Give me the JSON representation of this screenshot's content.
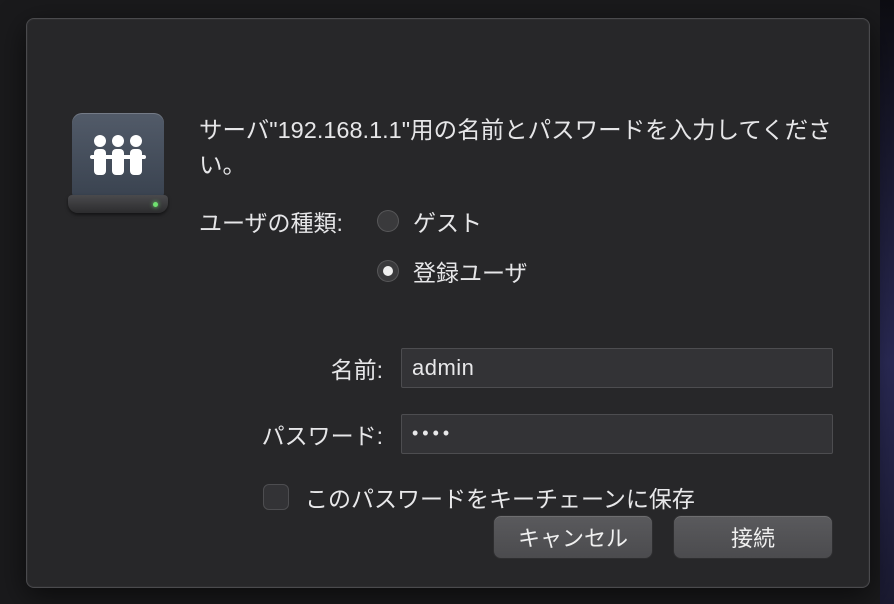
{
  "dialog": {
    "message": "サーバ\"192.168.1.1\"用の名前とパスワードを入力してください。",
    "user_type_label": "ユーザの種類:",
    "user_type": {
      "guest": "ゲスト",
      "registered": "登録ユーザ",
      "selected": "registered"
    },
    "name_label": "名前:",
    "name_value": "admin",
    "password_label": "パスワード:",
    "password_value": "••••",
    "keychain_label": "このパスワードをキーチェーンに保存",
    "keychain_checked": false,
    "cancel_label": "キャンセル",
    "connect_label": "接続"
  },
  "icon": {
    "name": "network-server-disk"
  }
}
